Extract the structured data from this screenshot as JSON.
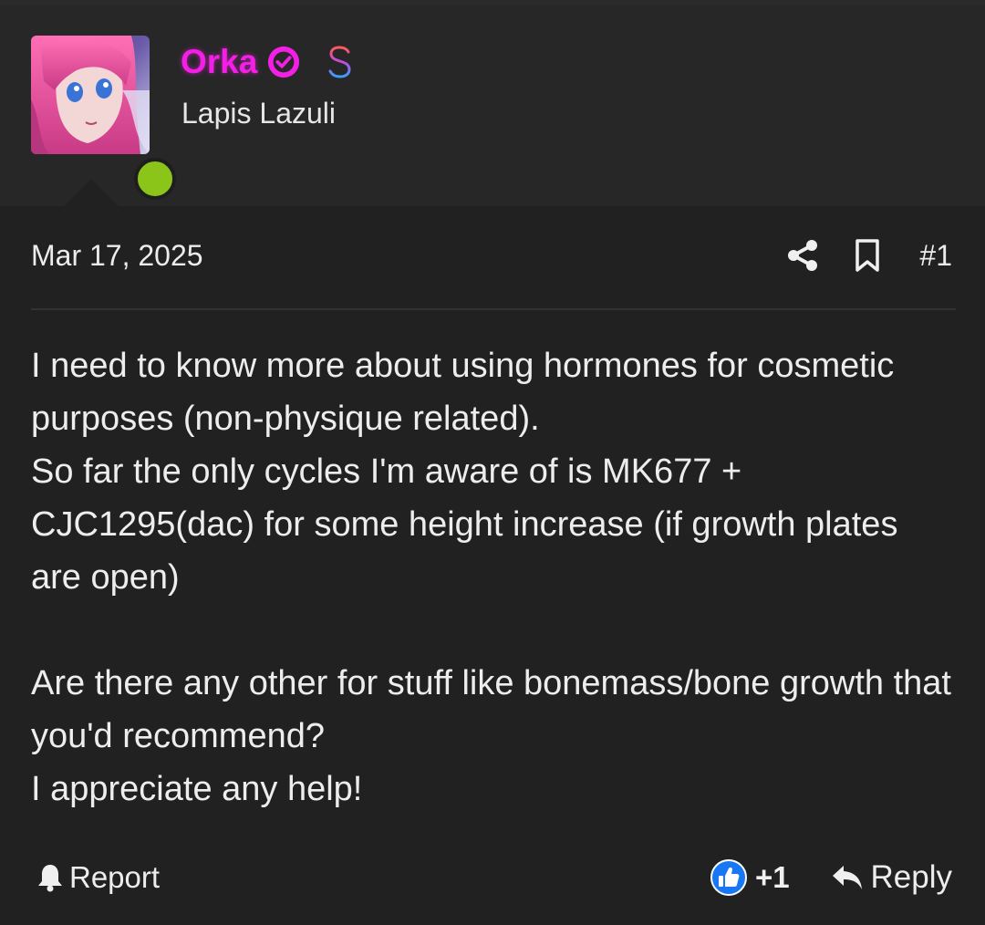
{
  "author": {
    "name": "Orka",
    "title": "Lapis Lazuli",
    "online": true,
    "name_color": "#f41fe6",
    "status_color": "#8cc51a",
    "badges": [
      "verified-badge-icon",
      "dollar-sign-icon"
    ]
  },
  "post": {
    "date": "Mar 17, 2025",
    "number": "#1",
    "paragraphs": [
      "I need to know more about using hormones for cosmetic purposes (non-physique related).",
      "So far the only cycles I'm aware of is MK677 + CJC1295(dac) for some height increase (if growth plates are open)",
      "",
      "Are there any other for stuff like bonemass/bone growth that you'd recommend?",
      "I appreciate any help!"
    ]
  },
  "actions": {
    "share_icon": "share-icon",
    "bookmark_icon": "bookmark-icon",
    "report_label": "Report",
    "report_icon": "bell-icon",
    "reaction_icon": "thumbs-up-icon",
    "reaction_count": "+1",
    "reply_label": "Reply",
    "reply_icon": "reply-arrow-icon",
    "reaction_color": "#1877f2"
  }
}
